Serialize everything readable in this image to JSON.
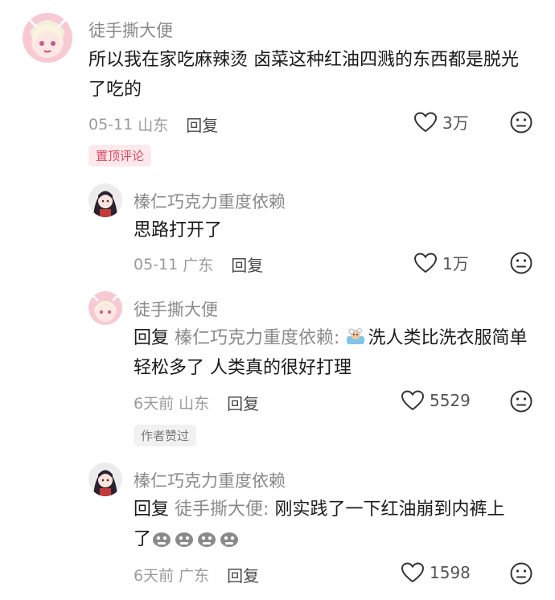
{
  "comments": [
    {
      "username": "徒手撕大便",
      "text": "所以我在家吃麻辣烫 卤菜这种红油四溅的东西都是脱光了吃的",
      "date": "05-11",
      "location": "山东",
      "reply_label": "回复",
      "likes": "3万",
      "badge": "置顶评论"
    },
    {
      "username": "榛仁巧克力重度依赖",
      "text": "思路打开了",
      "date": "05-11",
      "location": "广东",
      "reply_label": "回复",
      "likes": "1万"
    },
    {
      "username": "徒手撕大便",
      "reply_prefix": "回复",
      "reply_to": "榛仁巧克力重度依赖:",
      "text": "洗人类比洗衣服简单轻松多了 人类真的很好打理",
      "date": "6天前",
      "location": "山东",
      "reply_label": "回复",
      "likes": "5529",
      "badge": "作者赞过"
    },
    {
      "username": "榛仁巧克力重度依赖",
      "reply_prefix": "回复",
      "reply_to": "徒手撕大便:",
      "text_line1": "刚实践了一下红油崩到内裤上",
      "text_line2": "了",
      "date": "6天前",
      "location": "广东",
      "reply_label": "回复",
      "likes": "1598"
    }
  ],
  "icons": {
    "like": "heart-outline-icon",
    "dislike": "meh-face-icon",
    "emoji_bath": "bath-emoji-icon",
    "emoji_grimace": "grimace-emoji-icon"
  },
  "colors": {
    "username": "#8a8a8a",
    "pinned_badge_bg": "#fde9ec",
    "pinned_badge_text": "#e0455f",
    "author_badge_bg": "#f1f1f1"
  }
}
